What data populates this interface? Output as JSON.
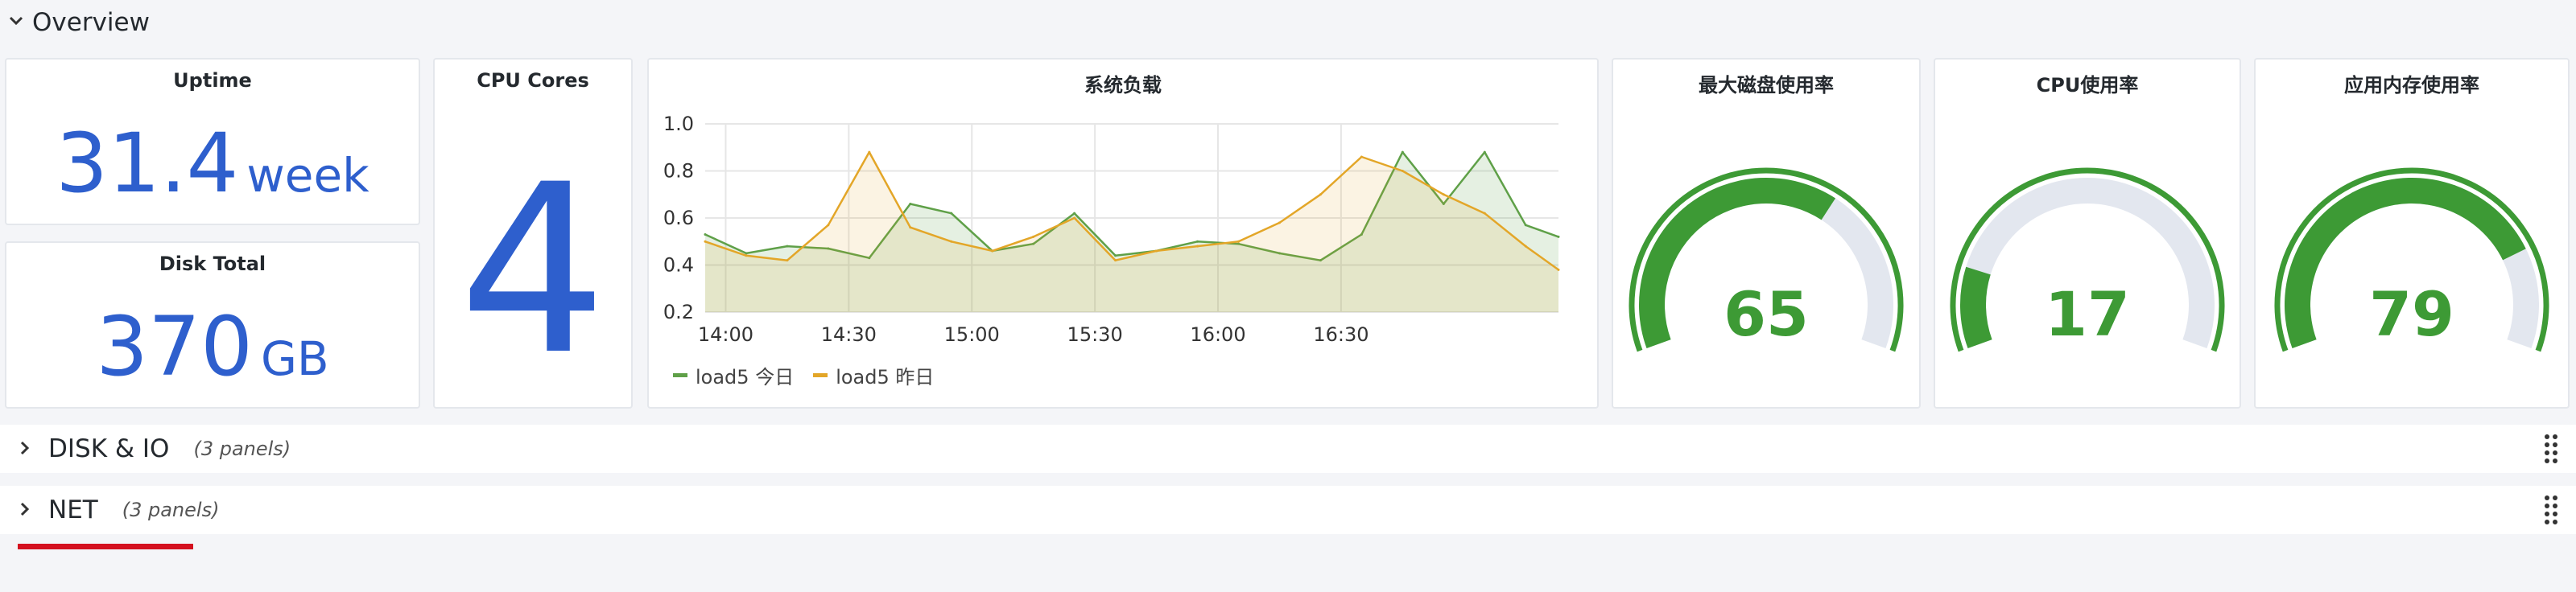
{
  "overview": {
    "title": "Overview"
  },
  "panels": {
    "uptime": {
      "title": "Uptime",
      "value": "31.4",
      "unit": "week"
    },
    "disk_total": {
      "title": "Disk Total",
      "value": "370",
      "unit": "GB"
    },
    "cpu_cores": {
      "title": "CPU Cores",
      "value": "4"
    },
    "load": {
      "title": "系统负载"
    },
    "gauges": [
      {
        "title": "最大磁盘使用率",
        "value": 65
      },
      {
        "title": "CPU使用率",
        "value": 17
      },
      {
        "title": "应用内存使用率",
        "value": 79
      }
    ]
  },
  "colors": {
    "accent_blue": "#2e5fcd",
    "gauge_green": "#3d9a35",
    "gauge_track": "#e3e7ef",
    "today": "#5fa048",
    "yesterday": "#e3a628",
    "alert_red": "#d4101f"
  },
  "icons": {
    "row_expanded": "chevron-down-icon",
    "row_collapsed": "chevron-right-icon",
    "drag": "drag-handle-icon"
  },
  "rows": [
    {
      "title": "DISK & IO",
      "count": "(3 panels)"
    },
    {
      "title": "NET",
      "count": "(3 panels)"
    }
  ],
  "chart_data": {
    "type": "area",
    "title": "系统负载",
    "xlabel": "",
    "ylabel": "",
    "ylim": [
      0.2,
      1.0
    ],
    "y_ticks": [
      "1.0",
      "0.8",
      "0.6",
      "0.4",
      "0.2"
    ],
    "x_ticks": [
      "14:00",
      "14:30",
      "15:00",
      "15:30",
      "16:00",
      "16:30"
    ],
    "x_range": [
      "13:55",
      "17:23"
    ],
    "legend_position": "bottom-left",
    "series": [
      {
        "name": "load5 今日",
        "color": "#5fa048",
        "x": [
          "13:55",
          "14:05",
          "14:15",
          "14:25",
          "14:35",
          "14:45",
          "14:55",
          "15:05",
          "15:15",
          "15:25",
          "15:35",
          "15:45",
          "15:55",
          "16:05",
          "16:15",
          "16:25",
          "16:35",
          "16:45",
          "16:55",
          "17:05",
          "17:15",
          "17:23"
        ],
        "values": [
          0.53,
          0.45,
          0.48,
          0.47,
          0.43,
          0.66,
          0.62,
          0.46,
          0.49,
          0.62,
          0.44,
          0.46,
          0.5,
          0.49,
          0.45,
          0.42,
          0.53,
          0.88,
          0.66,
          0.88,
          0.57,
          0.52
        ]
      },
      {
        "name": "load5 昨日",
        "color": "#e3a628",
        "x": [
          "13:55",
          "14:05",
          "14:15",
          "14:25",
          "14:35",
          "14:45",
          "14:55",
          "15:05",
          "15:15",
          "15:25",
          "15:35",
          "15:45",
          "15:55",
          "16:05",
          "16:15",
          "16:25",
          "16:35",
          "16:45",
          "16:55",
          "17:05",
          "17:15",
          "17:23"
        ],
        "values": [
          0.5,
          0.44,
          0.42,
          0.57,
          0.88,
          0.56,
          0.5,
          0.46,
          0.52,
          0.6,
          0.42,
          0.46,
          0.48,
          0.5,
          0.58,
          0.7,
          0.86,
          0.8,
          0.7,
          0.62,
          0.48,
          0.38
        ]
      }
    ]
  }
}
